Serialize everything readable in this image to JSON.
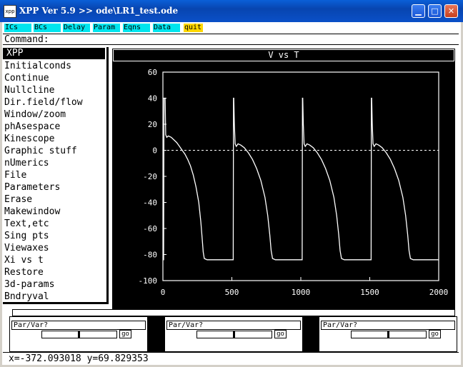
{
  "window": {
    "title": "XPP Ver 5.9 >> ode\\LR1_test.ode",
    "icon_label": "xpp",
    "controls": {
      "minimize": "▁",
      "maximize": "□",
      "close": "✕"
    }
  },
  "toolbar": {
    "buttons": [
      "ICs",
      "BCs",
      "Delay",
      "Param",
      "Eqns",
      "Data",
      "quit"
    ]
  },
  "command": {
    "label": "Command:"
  },
  "menu": {
    "title": "XPP",
    "items": [
      "Initialconds",
      "Continue",
      "Nullcline",
      "Dir.field/flow",
      "Window/zoom",
      "phAsespace",
      "Kinescope",
      "Graphic stuff",
      "nUmerics",
      "File",
      "Parameters",
      "Erase",
      "Makewindow",
      "Text,etc",
      "Sing pts",
      "Viewaxes",
      "Xi vs t",
      "Restore",
      "3d-params",
      "Bndryval"
    ]
  },
  "sliders": [
    {
      "label": "Par/Var?",
      "go": "go",
      "level": 0.48
    },
    {
      "label": "Par/Var?",
      "go": "go",
      "level": 0.48
    },
    {
      "label": "Par/Var?",
      "go": "go",
      "level": 0.48
    }
  ],
  "status": {
    "text": "x=-372.093018 y=69.829353"
  },
  "colors": {
    "toolbar_button": "#00e5ee",
    "quit_button": "#ffd700",
    "plot_background": "#000000",
    "trace": "#ffffff"
  },
  "chart_data": {
    "type": "line",
    "title": "V vs T",
    "xlabel": "",
    "ylabel": "",
    "xlim": [
      0,
      2000
    ],
    "ylim": [
      -100,
      60
    ],
    "x_ticks": [
      0,
      500,
      1000,
      1500,
      2000
    ],
    "y_ticks": [
      60,
      40,
      20,
      0,
      -20,
      -40,
      -60,
      -80,
      -100
    ],
    "reference_line": {
      "y": 0,
      "style": "dashed"
    },
    "grid": false,
    "series": [
      {
        "values": [
          [
            0,
            -84
          ],
          [
            5,
            -84
          ],
          [
            8,
            40
          ],
          [
            12,
            40
          ],
          [
            16,
            40
          ],
          [
            20,
            12
          ],
          [
            28,
            10
          ],
          [
            40,
            11
          ],
          [
            60,
            10
          ],
          [
            80,
            8
          ],
          [
            100,
            6
          ],
          [
            120,
            3
          ],
          [
            140,
            0
          ],
          [
            160,
            -3
          ],
          [
            180,
            -7
          ],
          [
            200,
            -12
          ],
          [
            220,
            -19
          ],
          [
            240,
            -28
          ],
          [
            260,
            -40
          ],
          [
            275,
            -55
          ],
          [
            285,
            -68
          ],
          [
            292,
            -78
          ],
          [
            300,
            -83
          ],
          [
            320,
            -84
          ],
          [
            500,
            -84
          ],
          [
            510,
            -84
          ],
          [
            512,
            40
          ],
          [
            514,
            40
          ],
          [
            518,
            20
          ],
          [
            524,
            5
          ],
          [
            532,
            3
          ],
          [
            545,
            5
          ],
          [
            565,
            4
          ],
          [
            590,
            2
          ],
          [
            620,
            -2
          ],
          [
            650,
            -7
          ],
          [
            680,
            -14
          ],
          [
            710,
            -23
          ],
          [
            740,
            -36
          ],
          [
            760,
            -50
          ],
          [
            775,
            -65
          ],
          [
            785,
            -77
          ],
          [
            795,
            -83
          ],
          [
            815,
            -84
          ],
          [
            1000,
            -84
          ],
          [
            1010,
            -84
          ],
          [
            1012,
            40
          ],
          [
            1014,
            40
          ],
          [
            1018,
            20
          ],
          [
            1024,
            5
          ],
          [
            1032,
            3
          ],
          [
            1045,
            5
          ],
          [
            1065,
            4
          ],
          [
            1090,
            2
          ],
          [
            1120,
            -2
          ],
          [
            1150,
            -7
          ],
          [
            1180,
            -14
          ],
          [
            1210,
            -23
          ],
          [
            1240,
            -36
          ],
          [
            1260,
            -50
          ],
          [
            1275,
            -65
          ],
          [
            1285,
            -77
          ],
          [
            1295,
            -83
          ],
          [
            1315,
            -84
          ],
          [
            1500,
            -84
          ],
          [
            1510,
            -84
          ],
          [
            1512,
            40
          ],
          [
            1514,
            40
          ],
          [
            1518,
            20
          ],
          [
            1524,
            5
          ],
          [
            1532,
            3
          ],
          [
            1545,
            5
          ],
          [
            1565,
            4
          ],
          [
            1590,
            2
          ],
          [
            1620,
            -2
          ],
          [
            1650,
            -7
          ],
          [
            1680,
            -14
          ],
          [
            1710,
            -23
          ],
          [
            1740,
            -36
          ],
          [
            1760,
            -50
          ],
          [
            1775,
            -65
          ],
          [
            1785,
            -77
          ],
          [
            1795,
            -83
          ],
          [
            1815,
            -84
          ],
          [
            2000,
            -84
          ]
        ]
      }
    ]
  }
}
